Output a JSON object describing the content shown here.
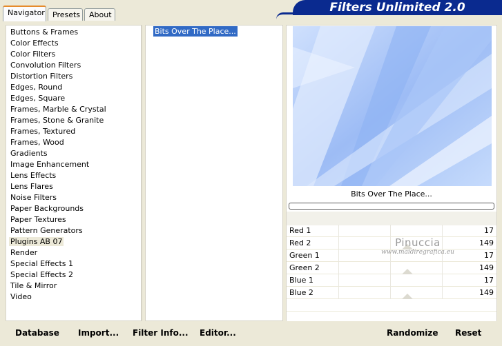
{
  "tabs": [
    {
      "label": "Navigator"
    },
    {
      "label": "Presets"
    },
    {
      "label": "About"
    }
  ],
  "brand": {
    "title": "Filters Unlimited 2.0"
  },
  "categories": [
    "Buttons & Frames",
    "Color Effects",
    "Color Filters",
    "Convolution Filters",
    "Distortion Filters",
    "Edges, Round",
    "Edges, Square",
    "Frames, Marble & Crystal",
    "Frames, Stone & Granite",
    "Frames, Textured",
    "Frames, Wood",
    "Gradients",
    "Image Enhancement",
    "Lens Effects",
    "Lens Flares",
    "Noise Filters",
    "Paper Backgrounds",
    "Paper Textures",
    "Pattern Generators",
    "Plugins AB 07",
    "Render",
    "Special Effects 1",
    "Special Effects 2",
    "Tile & Mirror",
    "Video"
  ],
  "selected_category": "Plugins AB 07",
  "filters": [
    "Bits Over The Place..."
  ],
  "current_filter": "Bits Over The Place...",
  "params": [
    {
      "name": "Red 1",
      "value": "17"
    },
    {
      "name": "Red 2",
      "value": "149"
    },
    {
      "name": "Green 1",
      "value": "17"
    },
    {
      "name": "Green 2",
      "value": "149"
    },
    {
      "name": "Blue 1",
      "value": "17"
    },
    {
      "name": "Blue 2",
      "value": "149"
    }
  ],
  "watermark": {
    "line1": "Pinuccia",
    "line2": "www.maidiregrafica.eu"
  },
  "buttons": {
    "database": "Database",
    "import": "Import...",
    "filter_info": "Filter Info...",
    "editor": "Editor...",
    "randomize": "Randomize",
    "reset": "Reset"
  },
  "colors": {
    "accent": "#0a2a8f",
    "selection": "#316ac5",
    "preview": "#b9d2fb"
  }
}
